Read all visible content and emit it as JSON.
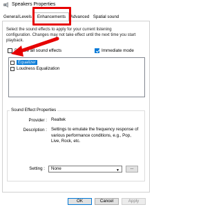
{
  "window": {
    "title": "Speakers Properties",
    "icon": "speaker-icon"
  },
  "tabs": [
    {
      "label": "General"
    },
    {
      "label": "Levels"
    },
    {
      "label": "Enhancements",
      "selected": true
    },
    {
      "label": "Advanced"
    },
    {
      "label": "Spatial sound"
    }
  ],
  "highlight_color": "#e60000",
  "instructions": {
    "line1": "Select the sound effects to apply for your current listening",
    "line2": "configuration. Changes may not take effect until the next time you start",
    "line3": "playback."
  },
  "disable_all": {
    "label": "Disable all sound effects",
    "checked": false
  },
  "immediate_mode": {
    "label": "Immediate mode",
    "checked": true
  },
  "effects": [
    {
      "label": "Equalizer",
      "checked": false,
      "selected": true
    },
    {
      "label": "Loudness Equalization",
      "checked": false,
      "selected": false
    }
  ],
  "properties": {
    "group_title": "Sound Effect Properties",
    "provider_label": "Provider :",
    "provider_value": "Realtek",
    "description_label": "Description :",
    "description_line1": "Settings to emulate the frequency response of",
    "description_line2": "various performance conditions,  e.g., Pop,",
    "description_line3": "Live, Rock, etc.",
    "setting_label": "Setting :",
    "setting_value": "None",
    "more_button": "..."
  },
  "buttons": {
    "ok": "OK",
    "cancel": "Cancel",
    "apply": "Apply"
  }
}
